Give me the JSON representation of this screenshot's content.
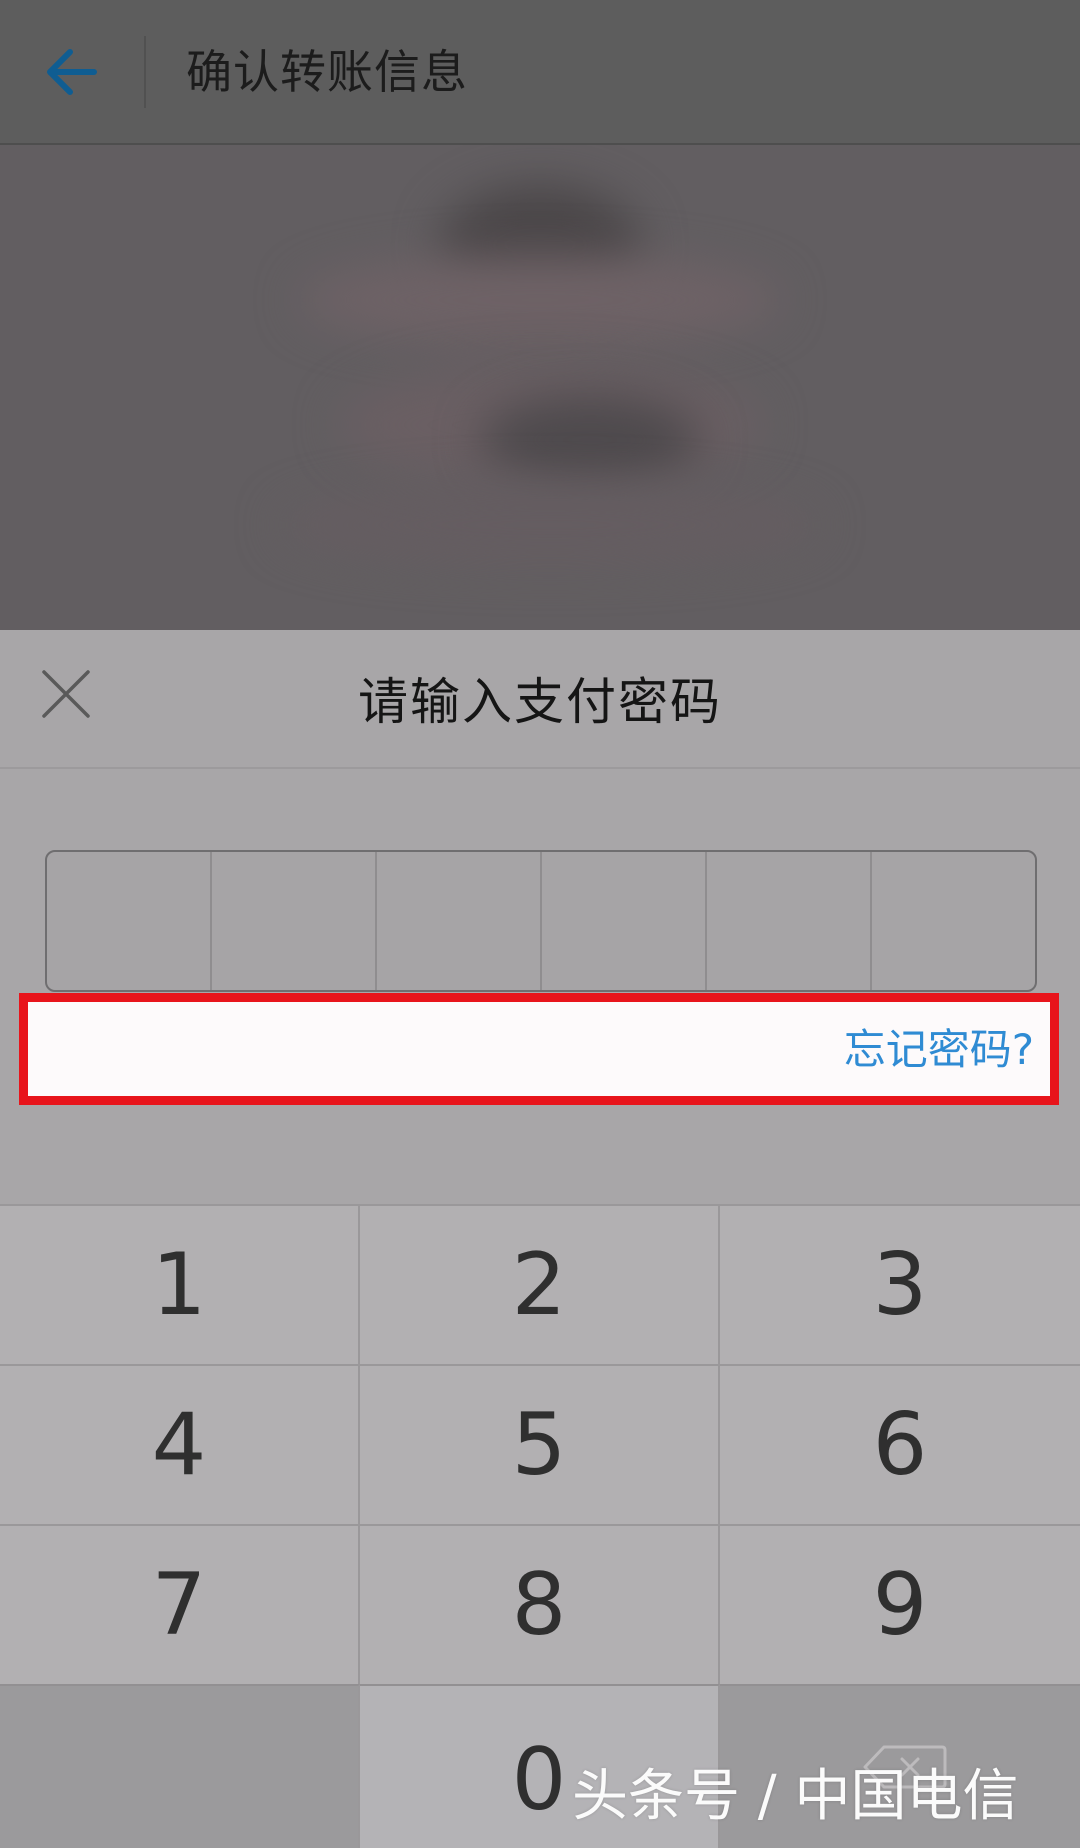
{
  "appbar": {
    "title": "确认转账信息",
    "back_icon": "arrow-left-icon",
    "accent": "#0f5d92"
  },
  "sheet": {
    "title": "请输入支付密码",
    "close_icon": "close-icon",
    "pin_length": 6,
    "forgot_label": "忘记密码?",
    "link_color": "#2f8bd3",
    "highlight_color": "#e8141b"
  },
  "keypad": {
    "keys": [
      "1",
      "2",
      "3",
      "4",
      "5",
      "6",
      "7",
      "8",
      "9",
      "",
      "0",
      ""
    ],
    "delete_icon": "backspace-icon"
  },
  "watermark": {
    "text": "头条号 / 中国电信"
  }
}
